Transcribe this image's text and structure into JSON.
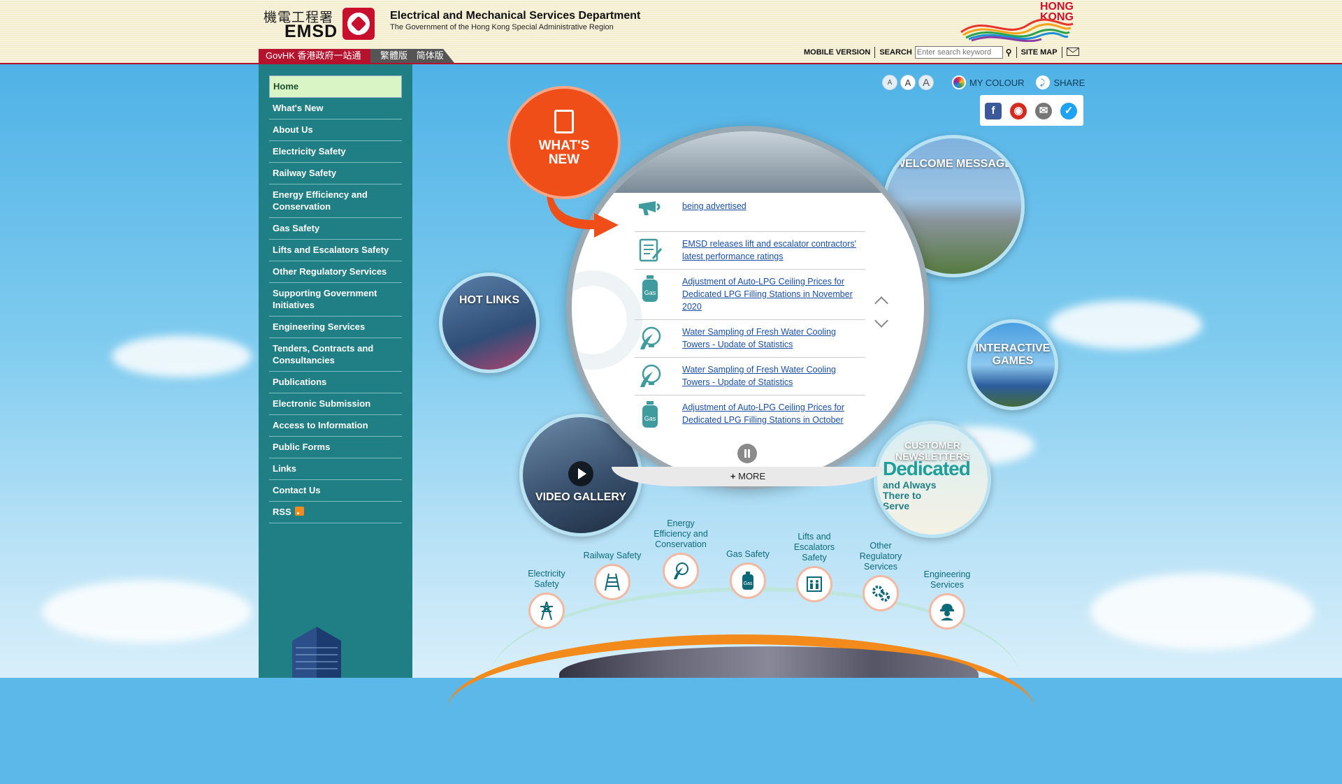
{
  "header": {
    "logo_cn": "機電工程署",
    "logo_abbr": "EMSD",
    "dept_title": "Electrical and Mechanical Services Department",
    "dept_subtitle": "The Government of the Hong Kong Special Administrative Region",
    "hk_logo_text": "HONG KONG",
    "govhk_label": "GovHK 香港政府一站通",
    "lang_trad": "繁體版",
    "lang_simp": "简体版",
    "mobile_version": "MOBILE VERSION",
    "search_label": "SEARCH",
    "search_placeholder": "Enter search keyword",
    "site_map": "SITE MAP"
  },
  "sidebar": {
    "items": [
      {
        "label": "Home"
      },
      {
        "label": "What's New"
      },
      {
        "label": "About Us"
      },
      {
        "label": "Electricity Safety"
      },
      {
        "label": "Railway Safety"
      },
      {
        "label": "Energy Efficiency and Conservation"
      },
      {
        "label": "Gas Safety"
      },
      {
        "label": "Lifts and Escalators Safety"
      },
      {
        "label": "Other Regulatory Services"
      },
      {
        "label": "Supporting Government Initiatives"
      },
      {
        "label": "Engineering Services"
      },
      {
        "label": "Tenders, Contracts and Consultancies"
      },
      {
        "label": "Publications"
      },
      {
        "label": "Electronic Submission"
      },
      {
        "label": "Access to Information"
      },
      {
        "label": "Public Forms"
      },
      {
        "label": "Links"
      },
      {
        "label": "Contact Us"
      },
      {
        "label": "RSS"
      }
    ]
  },
  "tools": {
    "font_small": "A",
    "font_medium": "A",
    "font_large": "A",
    "my_colour": "MY COLOUR",
    "share": "SHARE"
  },
  "whats_new": {
    "bubble_line1": "WHAT'S",
    "bubble_line2": "NEW",
    "items": [
      {
        "icon": "megaphone-icon",
        "text": "being advertised"
      },
      {
        "icon": "document-icon",
        "text": "EMSD releases lift and escalator contractors' latest performance ratings"
      },
      {
        "icon": "gas-cylinder-icon",
        "text": "Adjustment of Auto-LPG Ceiling Prices for Dedicated LPG Filling Stations in November 2020"
      },
      {
        "icon": "leaf-bulb-icon",
        "text": "Water Sampling of Fresh Water Cooling Towers - Update of Statistics"
      },
      {
        "icon": "leaf-bulb-icon",
        "text": "Water Sampling of Fresh Water Cooling Towers - Update of Statistics"
      },
      {
        "icon": "gas-cylinder-icon",
        "text": "Adjustment of Auto-LPG Ceiling Prices for Dedicated LPG Filling Stations in October"
      }
    ],
    "more_label": "MORE",
    "gas_tag": "Gas"
  },
  "satellites": {
    "welcome": "WELCOME MESSAGE",
    "hot_links": "HOT LINKS",
    "interactive_games": "INTERACTIVE GAMES",
    "video_gallery": "VIDEO GALLERY",
    "customer_newsletters": "CUSTOMER NEWSLETTERS",
    "newsletter_headline": "Dedicated",
    "newsletter_tagline": "and Always There to Serve"
  },
  "categories": [
    {
      "label": "Electricity Safety",
      "icon": "pylon-icon"
    },
    {
      "label": "Railway Safety",
      "icon": "railway-icon"
    },
    {
      "label": "Energy Efficiency and Conservation",
      "icon": "leaf-bulb-icon"
    },
    {
      "label": "Gas Safety",
      "icon": "gas-cylinder-icon"
    },
    {
      "label": "Lifts and Escalators Safety",
      "icon": "lift-icon"
    },
    {
      "label": "Other Regulatory Services",
      "icon": "gears-icon"
    },
    {
      "label": "Engineering Services",
      "icon": "worker-icon"
    }
  ],
  "colors": {
    "sidebar": "#1f7f84",
    "accent_red": "#b5122d",
    "whats_new_orange": "#f04e19",
    "link_blue": "#1a4fa8"
  }
}
